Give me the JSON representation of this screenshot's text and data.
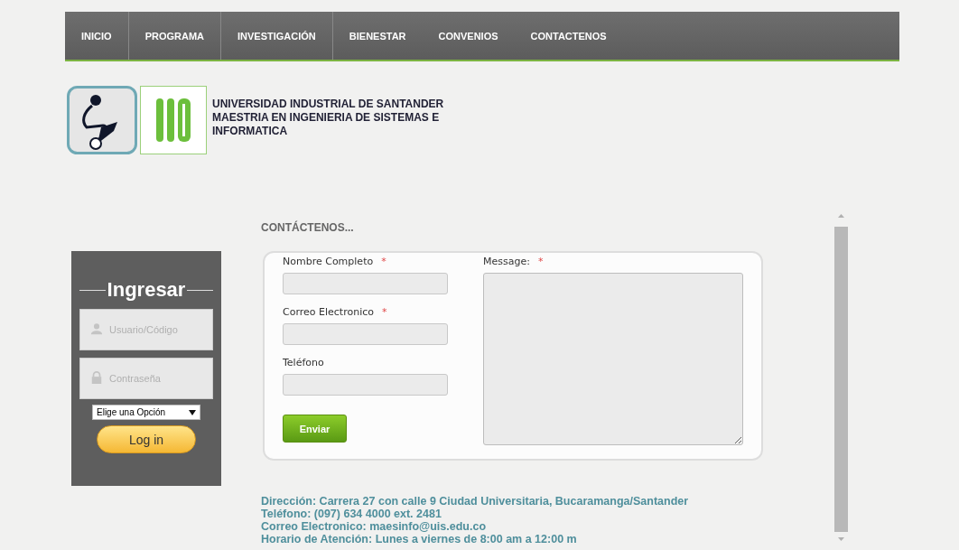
{
  "nav": [
    {
      "label": "INICIO"
    },
    {
      "label": "PROGRAMA"
    },
    {
      "label": "INVESTIGACIÓN"
    },
    {
      "label": "BIENESTAR"
    },
    {
      "label": "CONVENIOS"
    },
    {
      "label": "CONTACTENOS"
    }
  ],
  "header": {
    "lines": [
      "UNIVERSIDAD INDUSTRIAL DE SANTANDER",
      "MAESTRIA EN INGENIERIA DE SISTEMAS E",
      "INFORMATICA"
    ]
  },
  "login": {
    "title": "Ingresar",
    "fields": [
      {
        "kind": "user",
        "placeholder": "Usuario/Código"
      },
      {
        "kind": "lock",
        "placeholder": "Contraseña"
      }
    ],
    "select": "Elige una Opción",
    "button": "Log in"
  },
  "contact": {
    "heading": "CONTÁCTENOS...",
    "fields": [
      {
        "label": "Nombre Completo",
        "required": true
      },
      {
        "label": "Correo Electronico",
        "required": true
      },
      {
        "label": "Teléfono",
        "required": false
      }
    ],
    "message": {
      "label": "Message:",
      "required": true
    },
    "required_mark": "*",
    "button": "Enviar"
  },
  "footer": [
    "Dirección: Carrera 27 con calle 9 Ciudad Universitaria, Bucaramanga/Santander",
    "Teléfono: (097) 634 4000 ext. 2481",
    "Correo Electronico: maesinfo@uis.edu.co",
    "Horario de Atención: Lunes a viernes de 8:00 am a 12:00 m"
  ]
}
